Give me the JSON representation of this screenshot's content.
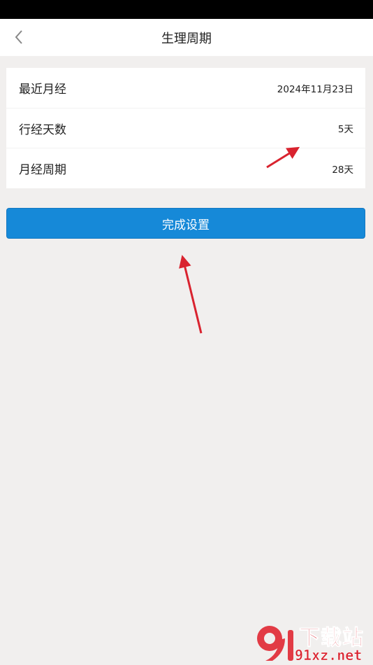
{
  "header": {
    "title": "生理周期",
    "back_icon": "chevron-left-icon"
  },
  "settings": {
    "rows": [
      {
        "label": "最近月经",
        "value": "2024年11月23日"
      },
      {
        "label": "行经天数",
        "value": "5天"
      },
      {
        "label": "月经周期",
        "value": "28天"
      }
    ]
  },
  "actions": {
    "done_label": "完成设置"
  },
  "watermark": {
    "brand_top": "下载站",
    "brand_bottom": "91xz.net",
    "logo_text": "9"
  },
  "colors": {
    "accent": "#1689d8",
    "annotation_arrow": "#d9232f",
    "background": "#f1efee"
  }
}
